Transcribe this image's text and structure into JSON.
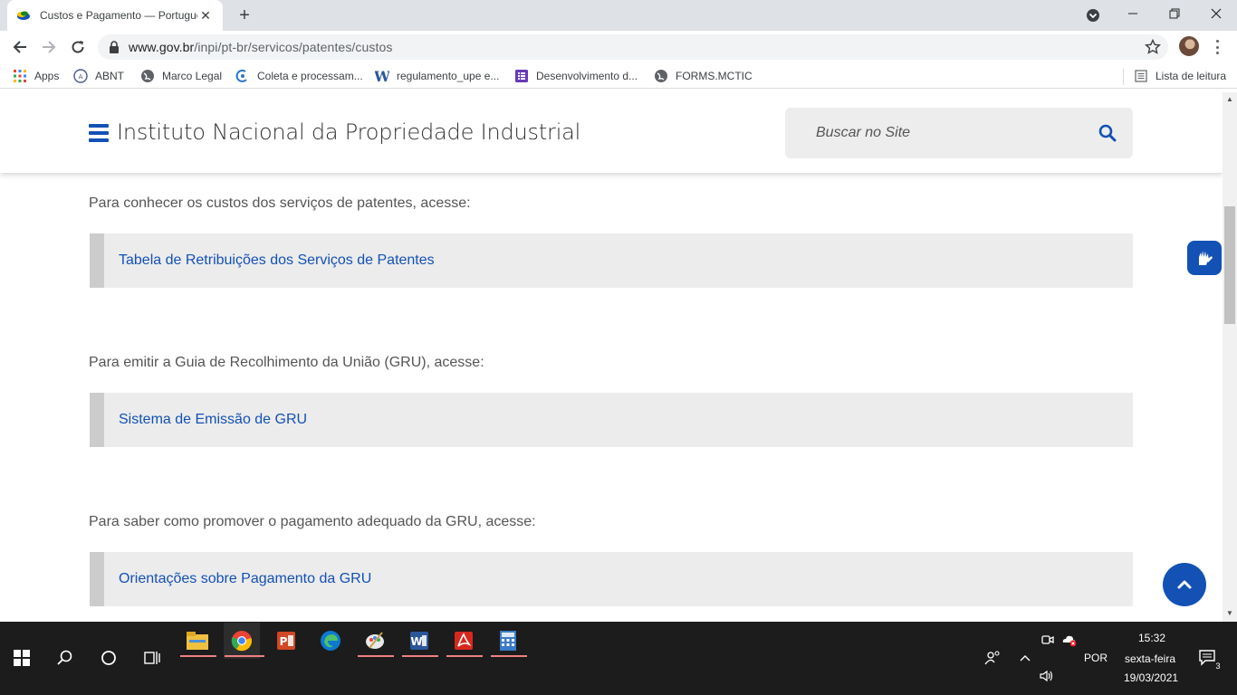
{
  "browser": {
    "tab_title": "Custos e Pagamento — Português",
    "url_host": "www.gov.br",
    "url_path": "/inpi/pt-br/servicos/patentes/custos",
    "bookmarks": [
      {
        "label": "Apps",
        "icon": "apps-grid-icon"
      },
      {
        "label": "ABNT",
        "icon": "abnt-icon"
      },
      {
        "label": "Marco Legal",
        "icon": "globe-icon"
      },
      {
        "label": "Coleta e processam...",
        "icon": "coleta-icon"
      },
      {
        "label": "regulamento_upe e...",
        "icon": "word-w-icon"
      },
      {
        "label": "Desenvolvimento d...",
        "icon": "forms-icon"
      },
      {
        "label": "FORMS.MCTIC",
        "icon": "globe-icon"
      }
    ],
    "reading_list": "Lista de leitura"
  },
  "header": {
    "title": "Instituto Nacional da Propriedade Industrial",
    "search_placeholder": "Buscar no Site"
  },
  "content": {
    "sections": [
      {
        "intro": "Para conhecer os custos dos serviços de patentes, acesse:",
        "link": "Tabela de Retribuições dos Serviços de Patentes"
      },
      {
        "intro": "Para emitir a Guia de Recolhimento da União (GRU), acesse:",
        "link": "Sistema de Emissão de GRU"
      },
      {
        "intro": "Para saber como promover o pagamento adequado da GRU, acesse:",
        "link": "Orientações sobre Pagamento da GRU"
      }
    ]
  },
  "taskbar": {
    "language": "POR",
    "time": "15:32",
    "day": "sexta-feira",
    "date": "19/03/2021",
    "notifications": "3"
  },
  "colors": {
    "primary": "#1351b4",
    "link_box_bg": "#ececec",
    "link_box_border": "#cccccc"
  }
}
